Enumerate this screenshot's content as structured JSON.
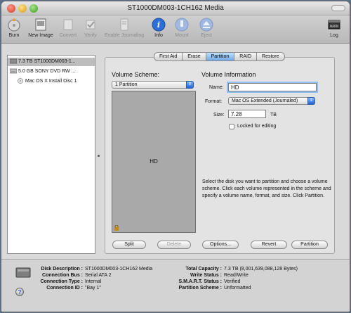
{
  "window": {
    "title": "ST1000DM003-1CH162 Media"
  },
  "toolbar": {
    "burn": "Burn",
    "new_image": "New Image",
    "convert": "Convert",
    "verify": "Verify",
    "enable_journaling": "Enable Journaling",
    "info": "Info",
    "mount": "Mount",
    "eject": "Eject",
    "log": "Log"
  },
  "sidebar": {
    "items": [
      {
        "label": "7.3 TB ST1000DM003-1...",
        "icon": "hard-disk-icon",
        "selected": true
      },
      {
        "label": "5.0 GB SONY    DVD RW ...",
        "icon": "optical-drive-icon",
        "selected": false
      },
      {
        "label": "Mac OS X Install Disc 1",
        "icon": "disc-icon",
        "selected": false
      }
    ]
  },
  "tabs": [
    "First Aid",
    "Erase",
    "Partition",
    "RAID",
    "Restore"
  ],
  "partition": {
    "scheme_title": "Volume Scheme:",
    "scheme_value": "1 Partition",
    "scheme_block_label": "HD",
    "info_title": "Volume Information",
    "name_label": "Name:",
    "name_value": "HD",
    "format_label": "Format:",
    "format_value": "Mac OS Extended (Journaled)",
    "size_label": "Size:",
    "size_value": "7.28",
    "size_unit": "TB",
    "locked_label": "Locked for editing",
    "description": "Select the disk you want to partition and choose a volume scheme. Click each volume represented in the scheme and specify a volume name, format, and size. Click Partition."
  },
  "buttons": {
    "split": "Split",
    "delete": "Delete",
    "options": "Options...",
    "revert": "Revert",
    "partition": "Partition"
  },
  "info": {
    "disk_description_k": "Disk Description :",
    "disk_description_v": "ST1000DM003-1CH162 Media",
    "connection_bus_k": "Connection Bus :",
    "connection_bus_v": "Serial ATA 2",
    "connection_type_k": "Connection Type :",
    "connection_type_v": "Internal",
    "connection_id_k": "Connection ID :",
    "connection_id_v": "\"Bay 1\"",
    "total_capacity_k": "Total Capacity :",
    "total_capacity_v": "7.3 TB (8,001,639,088,128 Bytes)",
    "write_status_k": "Write Status :",
    "write_status_v": "Read/Write",
    "smart_status_k": "S.M.A.R.T. Status :",
    "smart_status_v": "Verified",
    "partition_scheme_k": "Partition Scheme :",
    "partition_scheme_v": "Unformatted"
  },
  "help": "?"
}
